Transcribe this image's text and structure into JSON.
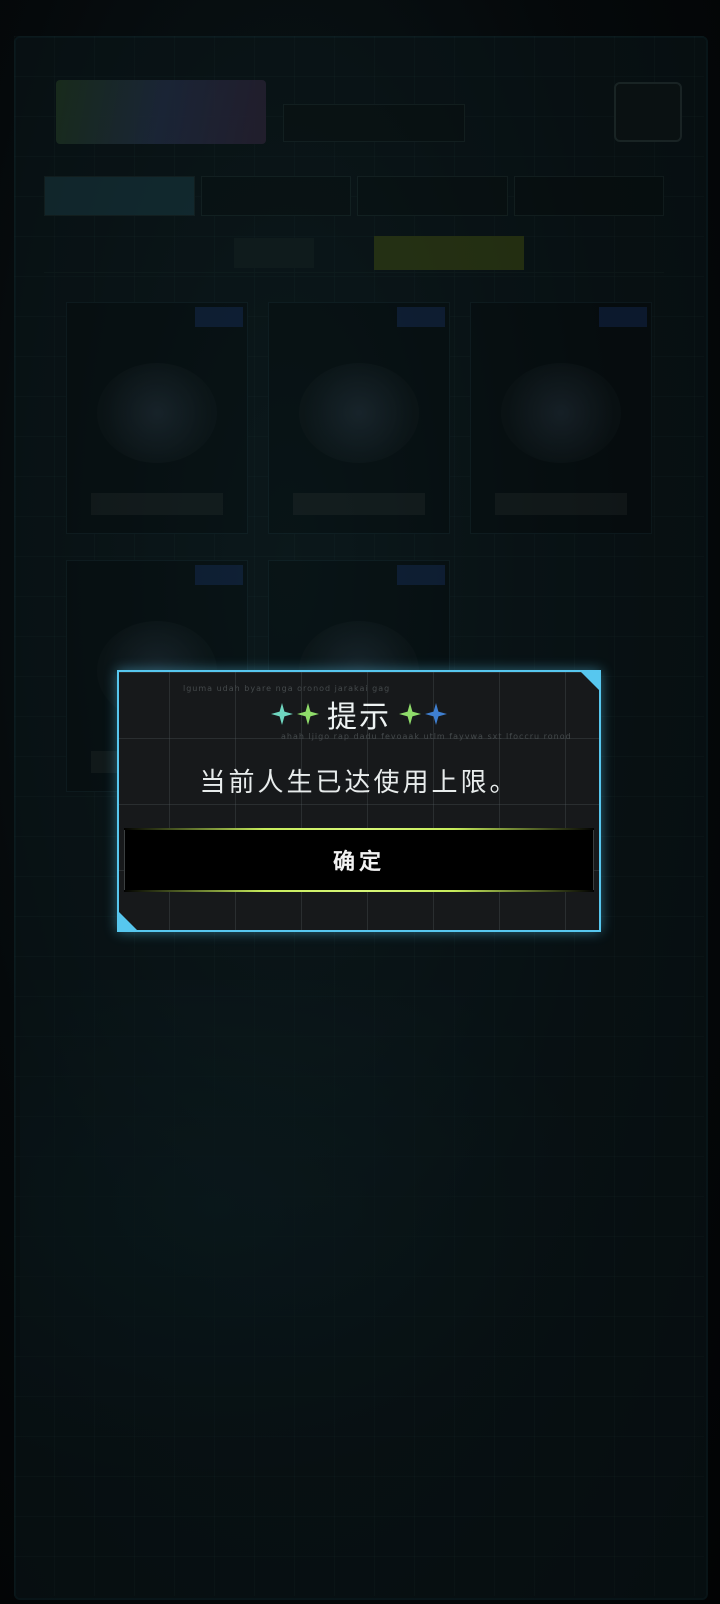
{
  "dialog": {
    "title": "提示",
    "message": "当前人生已达使用上限。",
    "confirm_label": "确定",
    "deco_top": "lguma udah byare nga oronod jarakai gag",
    "deco_bottom": "ahah ljigo rap dadu fevoaak utlm fayvwa sxt lfoccru ronod"
  },
  "colors": {
    "dialog_border": "#57c7ef",
    "button_glow": "#c7ec5c",
    "star_teal": "#6fd6c0",
    "star_green": "#8fdc6a",
    "star_blue": "#3f7fd0"
  },
  "icons": {
    "title_left_stars": [
      "sparkle-star-icon",
      "sparkle-star-icon"
    ],
    "title_right_stars": [
      "sparkle-star-icon",
      "sparkle-star-icon"
    ]
  }
}
